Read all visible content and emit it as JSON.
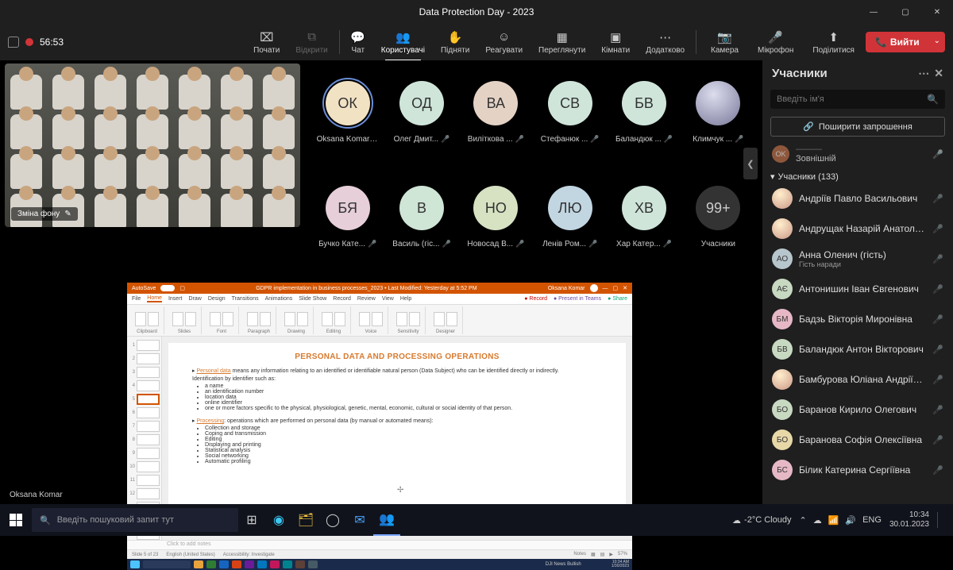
{
  "titlebar": {
    "title": "Data Protection Day - 2023"
  },
  "toolbar": {
    "timer": "56:53",
    "buttons": {
      "start": "Почати",
      "open": "Відкрити",
      "chat": "Чат",
      "people": "Користувачі",
      "raise": "Підняти",
      "react": "Реагувати",
      "view": "Переглянути",
      "rooms": "Кімнати",
      "more": "Додатково",
      "camera": "Камера",
      "mic": "Мікрофон",
      "share": "Поділитися",
      "leave": "Вийти"
    }
  },
  "together": {
    "change_bg": "Зміна фону"
  },
  "avatars": [
    {
      "initials": "ОК",
      "name": "Oksana Komar",
      "bg": "#f2e2c4",
      "ring": true
    },
    {
      "initials": "ОД",
      "name": "Олег Дмит...",
      "bg": "#cfe5da"
    },
    {
      "initials": "ВА",
      "name": "Виліткова ...",
      "bg": "#e4d2c5"
    },
    {
      "initials": "СВ",
      "name": "Стефанюк ...",
      "bg": "#cfe5da"
    },
    {
      "initials": "БВ",
      "name": "Баландюк ...",
      "bg": "#cfe5da"
    },
    {
      "initials": "",
      "name": "Климчук ...",
      "bg": "#888",
      "img": true
    },
    {
      "initials": "БЯ",
      "name": "Бучко Кате...",
      "bg": "#e6cfd9"
    },
    {
      "initials": "В",
      "name": "Василь (гіс...",
      "bg": "#cfe5d6"
    },
    {
      "initials": "НО",
      "name": "Новосад В...",
      "bg": "#d6e2c2"
    },
    {
      "initials": "ЛЮ",
      "name": "Ленів Ром...",
      "bg": "#c2d6e2"
    },
    {
      "initials": "ХВ",
      "name": "Хар Катер...",
      "bg": "#cfe5da"
    },
    {
      "initials": "99+",
      "name": "Учасники",
      "bg": "#333",
      "count": true
    }
  ],
  "presenter_label": "Oksana Komar",
  "powerpoint": {
    "autosave": "AutoSave",
    "filename": "GDPR implementation in business processes_2023 • Last Modified: Yesterday at 5:52 PM",
    "user": "Oksana Komar",
    "tabs": [
      "File",
      "Home",
      "Insert",
      "Draw",
      "Design",
      "Transitions",
      "Animations",
      "Slide Show",
      "Record",
      "Review",
      "View",
      "Help"
    ],
    "active_tab": "Home",
    "record": "Record",
    "present": "Present in Teams",
    "share": "Share",
    "groups": [
      "Clipboard",
      "Slides",
      "Font",
      "Paragraph",
      "Drawing",
      "Editing",
      "Voice",
      "Sensitivity",
      "Designer"
    ],
    "slide_count": 23,
    "current_slide": 5,
    "slide": {
      "title": "PERSONAL DATA AND PROCESSING OPERATIONS",
      "pd_label": "Personal data",
      "pd_text": " means any information relating to an identified or identifiable natural person (Data Subject) who can be identified directly or indirectly.",
      "ident": "Identification by identifier such as:",
      "ident_items": [
        "a name",
        "an identification number",
        "location data",
        "online identifier",
        "one or more factors specific to the physical, physiological, genetic, mental, economic, cultural or social identity of that person."
      ],
      "proc_label": "Processing",
      "proc_text": ": operations which are performed on personal data (by manual or automated means):",
      "proc_items": [
        "Collection and storage",
        "Coping and transmission",
        "Editing",
        "Displaying and printing",
        "Statistical analysis",
        "Social networking",
        "Automatic profiling"
      ]
    },
    "notes_placeholder": "Click to add notes",
    "status": {
      "slide": "Slide 5 of 23",
      "lang": "English (United States)",
      "access": "Accessibility: Investigate",
      "notes": "Notes",
      "zoom": "57%"
    },
    "wintask": {
      "news": "DJI  News Bullish",
      "time": "10:34 AM",
      "date": "1/30/2023"
    }
  },
  "panel": {
    "title": "Учасники",
    "search_placeholder": "Введіть ім'я",
    "share_invite": "Поширити запрошення",
    "external_sub": "Зовнішній",
    "section": "Учасники (133)",
    "people": [
      {
        "av": "",
        "name": "Андріїв Павло Васильович",
        "bg": "#e8c8d8",
        "img": true
      },
      {
        "av": "",
        "name": "Андрущак Назарій Анатолійович",
        "bg": "#d8e0f0",
        "img": true
      },
      {
        "av": "АО",
        "name": "Анна Оленич (гість)",
        "bg": "#b7c6cc",
        "sub": "Гість наради"
      },
      {
        "av": "АЄ",
        "name": "Антонишин Іван Євгенович",
        "bg": "#c7d9c1"
      },
      {
        "av": "БМ",
        "name": "Бадзь Вікторія Миронівна",
        "bg": "#e6b8c6"
      },
      {
        "av": "БВ",
        "name": "Баландюк Антон Вікторович",
        "bg": "#c7d9c1"
      },
      {
        "av": "",
        "name": "Бамбурова Юліана Андріївна",
        "bg": "#d8c8e0",
        "img": true
      },
      {
        "av": "БО",
        "name": "Баранов Кирило Олегович",
        "bg": "#c7d9c1"
      },
      {
        "av": "БО",
        "name": "Баранова Софія Олексіївна",
        "bg": "#e8d8a8"
      },
      {
        "av": "БС",
        "name": "Білик Катерина Сергіївна",
        "bg": "#e6b8c6"
      }
    ]
  },
  "wintask": {
    "search_placeholder": "Введіть пошуковий запит тут",
    "weather": "-2°C  Cloudy",
    "lang": "ENG",
    "time": "10:34",
    "date": "30.01.2023"
  }
}
